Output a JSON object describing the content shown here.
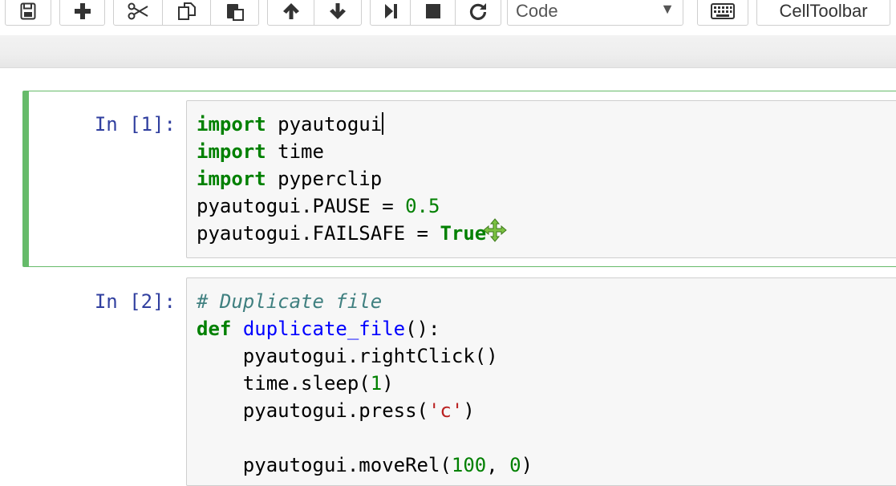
{
  "toolbar": {
    "celltype_value": "Code",
    "celltoolbar_label": "CellToolbar",
    "icons": [
      "save-icon",
      "plus-icon",
      "cut-icon",
      "copy-icon",
      "paste-icon",
      "arrow-up-icon",
      "arrow-down-icon",
      "step-forward-icon",
      "stop-icon",
      "restart-icon",
      "keyboard-icon"
    ]
  },
  "cells": [
    {
      "prompt": "In [1]:",
      "lines": [
        {
          "kw": "import",
          "rest": " pyautogui"
        },
        {
          "kw": "import",
          "rest": " time"
        },
        {
          "kw": "import",
          "rest": " pyperclip"
        },
        {
          "pre": "pyautogui.PAUSE = ",
          "num": "0.5"
        },
        {
          "pre": "pyautogui.FAILSAFE = ",
          "kwval": "True"
        }
      ]
    },
    {
      "prompt": "In [2]:",
      "lines": [
        {
          "comment": "# Duplicate file"
        },
        {
          "kw": "def",
          "fname": "duplicate_file",
          "tail": "():"
        },
        {
          "text": "    pyautogui.rightClick()"
        },
        {
          "pre": "    time.sleep(",
          "num": "1",
          "post": ")"
        },
        {
          "pre": "    pyautogui.press(",
          "str": "'c'",
          "post": ")"
        },
        {
          "text": ""
        },
        {
          "pre": "    pyautogui.moveRel(",
          "num": "100",
          "mid": ", ",
          "num2": "0",
          "post": ")"
        }
      ]
    }
  ]
}
